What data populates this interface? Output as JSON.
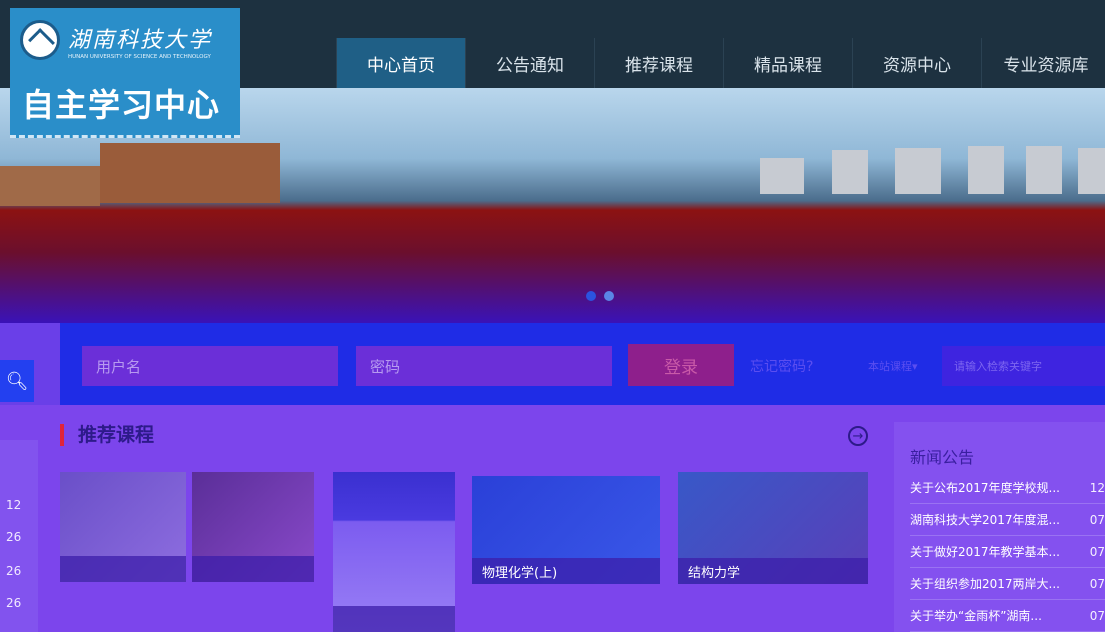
{
  "logo": {
    "school_cn": "湖南科技大学",
    "school_en": "HUNAN UNIVERSITY OF SCIENCE AND TECHNOLOGY",
    "title": "自主学习中心"
  },
  "nav": {
    "items": [
      {
        "label": "中心首页",
        "active": true
      },
      {
        "label": "公告通知",
        "active": false
      },
      {
        "label": "推荐课程",
        "active": false
      },
      {
        "label": "精品课程",
        "active": false
      },
      {
        "label": "资源中心",
        "active": false
      },
      {
        "label": "专业资源库",
        "active": false
      }
    ]
  },
  "banner": {
    "slide_count": 2,
    "active_slide": 1
  },
  "login": {
    "username_placeholder": "用户名",
    "password_placeholder": "密码",
    "login_label": "登录",
    "forgot_label": "忘记密码?",
    "scope_label": "本站课程▾",
    "keyword_placeholder": "请输入检索关键字",
    "search_icon": "search-icon"
  },
  "left_numbers": [
    "12",
    "26",
    "26",
    "26"
  ],
  "recommend": {
    "title": "推荐课程",
    "cards": [
      {
        "label": ""
      },
      {
        "label": ""
      },
      {
        "label": ""
      },
      {
        "label": "物理化学(上)"
      },
      {
        "label": "结构力学"
      }
    ]
  },
  "news": {
    "title": "新闻公告",
    "items": [
      {
        "text": "关于公布2017年度学校规...",
        "date": "12"
      },
      {
        "text": "湖南科技大学2017年度混...",
        "date": "07"
      },
      {
        "text": "关于做好2017年教学基本...",
        "date": "07"
      },
      {
        "text": "关于组织参加2017两岸大...",
        "date": "07"
      },
      {
        "text": "关于举办“金雨杯”湖南...",
        "date": "07"
      }
    ]
  },
  "colors": {
    "nav_bg": "#1d3140",
    "nav_active": "#1f5f86",
    "logo_bg": "#2a8ec9",
    "accent": "#e0243a"
  }
}
